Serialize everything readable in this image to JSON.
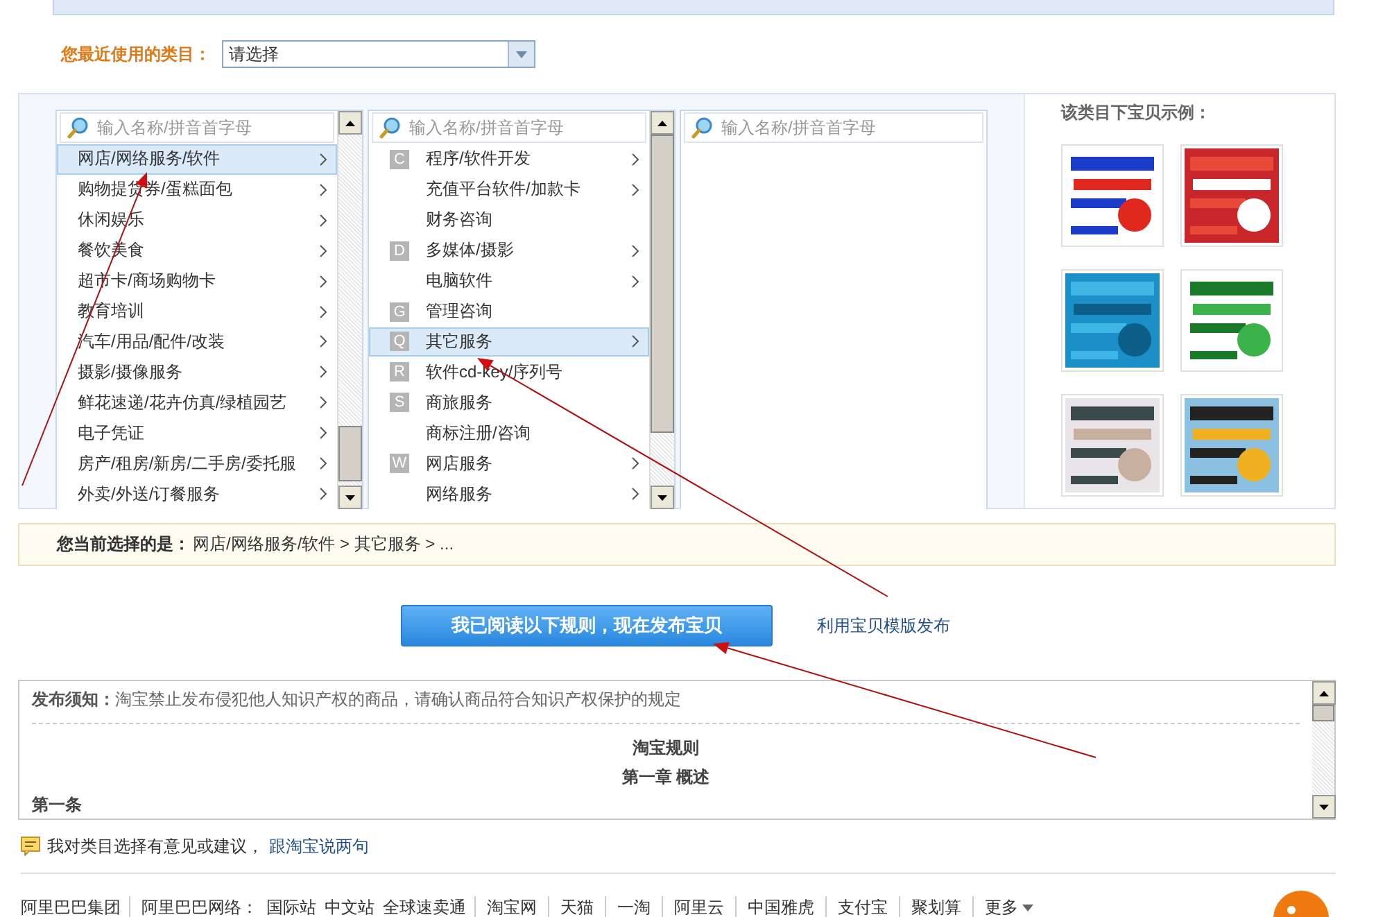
{
  "recent_category": {
    "label": "您最近使用的类目：",
    "value": "请选择"
  },
  "columns": [
    {
      "placeholder": "输入名称/拼音首字母",
      "items": [
        {
          "label": "网店/网络服务/软件",
          "has_children": true,
          "selected": true
        },
        {
          "label": "购物提货券/蛋糕面包",
          "has_children": true,
          "selected": false
        },
        {
          "label": "休闲娱乐",
          "has_children": true,
          "selected": false
        },
        {
          "label": "餐饮美食",
          "has_children": true,
          "selected": false
        },
        {
          "label": "超市卡/商场购物卡",
          "has_children": true,
          "selected": false
        },
        {
          "label": "教育培训",
          "has_children": true,
          "selected": false
        },
        {
          "label": "汽车/用品/配件/改装",
          "has_children": true,
          "selected": false
        },
        {
          "label": "摄影/摄像服务",
          "has_children": true,
          "selected": false
        },
        {
          "label": "鲜花速递/花卉仿真/绿植园艺",
          "has_children": true,
          "selected": false
        },
        {
          "label": "电子凭证",
          "has_children": true,
          "selected": false
        },
        {
          "label": "房产/租房/新房/二手房/委托服",
          "has_children": true,
          "selected": false
        },
        {
          "label": "外卖/外送/订餐服务",
          "has_children": true,
          "selected": false
        }
      ]
    },
    {
      "placeholder": "输入名称/拼音首字母",
      "items": [
        {
          "letter": "C",
          "label": "程序/软件开发",
          "has_children": true,
          "selected": false
        },
        {
          "label": "充值平台软件/加款卡",
          "has_children": true,
          "selected": false
        },
        {
          "label": "财务咨询",
          "has_children": false,
          "selected": false
        },
        {
          "letter": "D",
          "label": "多媒体/摄影",
          "has_children": true,
          "selected": false
        },
        {
          "label": "电脑软件",
          "has_children": true,
          "selected": false
        },
        {
          "letter": "G",
          "label": "管理咨询",
          "has_children": false,
          "selected": false
        },
        {
          "letter": "Q",
          "label": "其它服务",
          "has_children": true,
          "selected": true
        },
        {
          "letter": "R",
          "label": "软件cd-key/序列号",
          "has_children": false,
          "selected": false
        },
        {
          "letter": "S",
          "label": "商旅服务",
          "has_children": false,
          "selected": false
        },
        {
          "label": "商标注册/咨询",
          "has_children": false,
          "selected": false
        },
        {
          "letter": "W",
          "label": "网店服务",
          "has_children": true,
          "selected": false
        },
        {
          "label": "网络服务",
          "has_children": true,
          "selected": false
        }
      ]
    },
    {
      "placeholder": "输入名称/拼音首字母"
    }
  ],
  "examples": {
    "title": "该类目下宝贝示例："
  },
  "current_selection": {
    "label": "您当前选择的是：",
    "path": "网店/网络服务/软件 > 其它服务 > ..."
  },
  "publish_button": "我已阅读以下规则，现在发布宝贝",
  "template_link": "利用宝贝模版发布",
  "notice": {
    "label": "发布须知：",
    "text": "淘宝禁止发布侵犯他人知识产权的商品，请确认商品符合知识产权保护的规定"
  },
  "rules": {
    "title": "淘宝规则",
    "chapter": "第一章 概述",
    "article": "第一条"
  },
  "feedback": {
    "text": "我对类目选择有意见或建议，",
    "link": "跟淘宝说两句"
  },
  "footer": {
    "group": "阿里巴巴集团",
    "network_label": "阿里巴巴网络：",
    "links": [
      "国际站",
      "中文站",
      "全球速卖通",
      "淘宝网",
      "天猫",
      "一淘",
      "阿里云",
      "中国雅虎",
      "支付宝",
      "聚划算"
    ],
    "more": "更多"
  }
}
